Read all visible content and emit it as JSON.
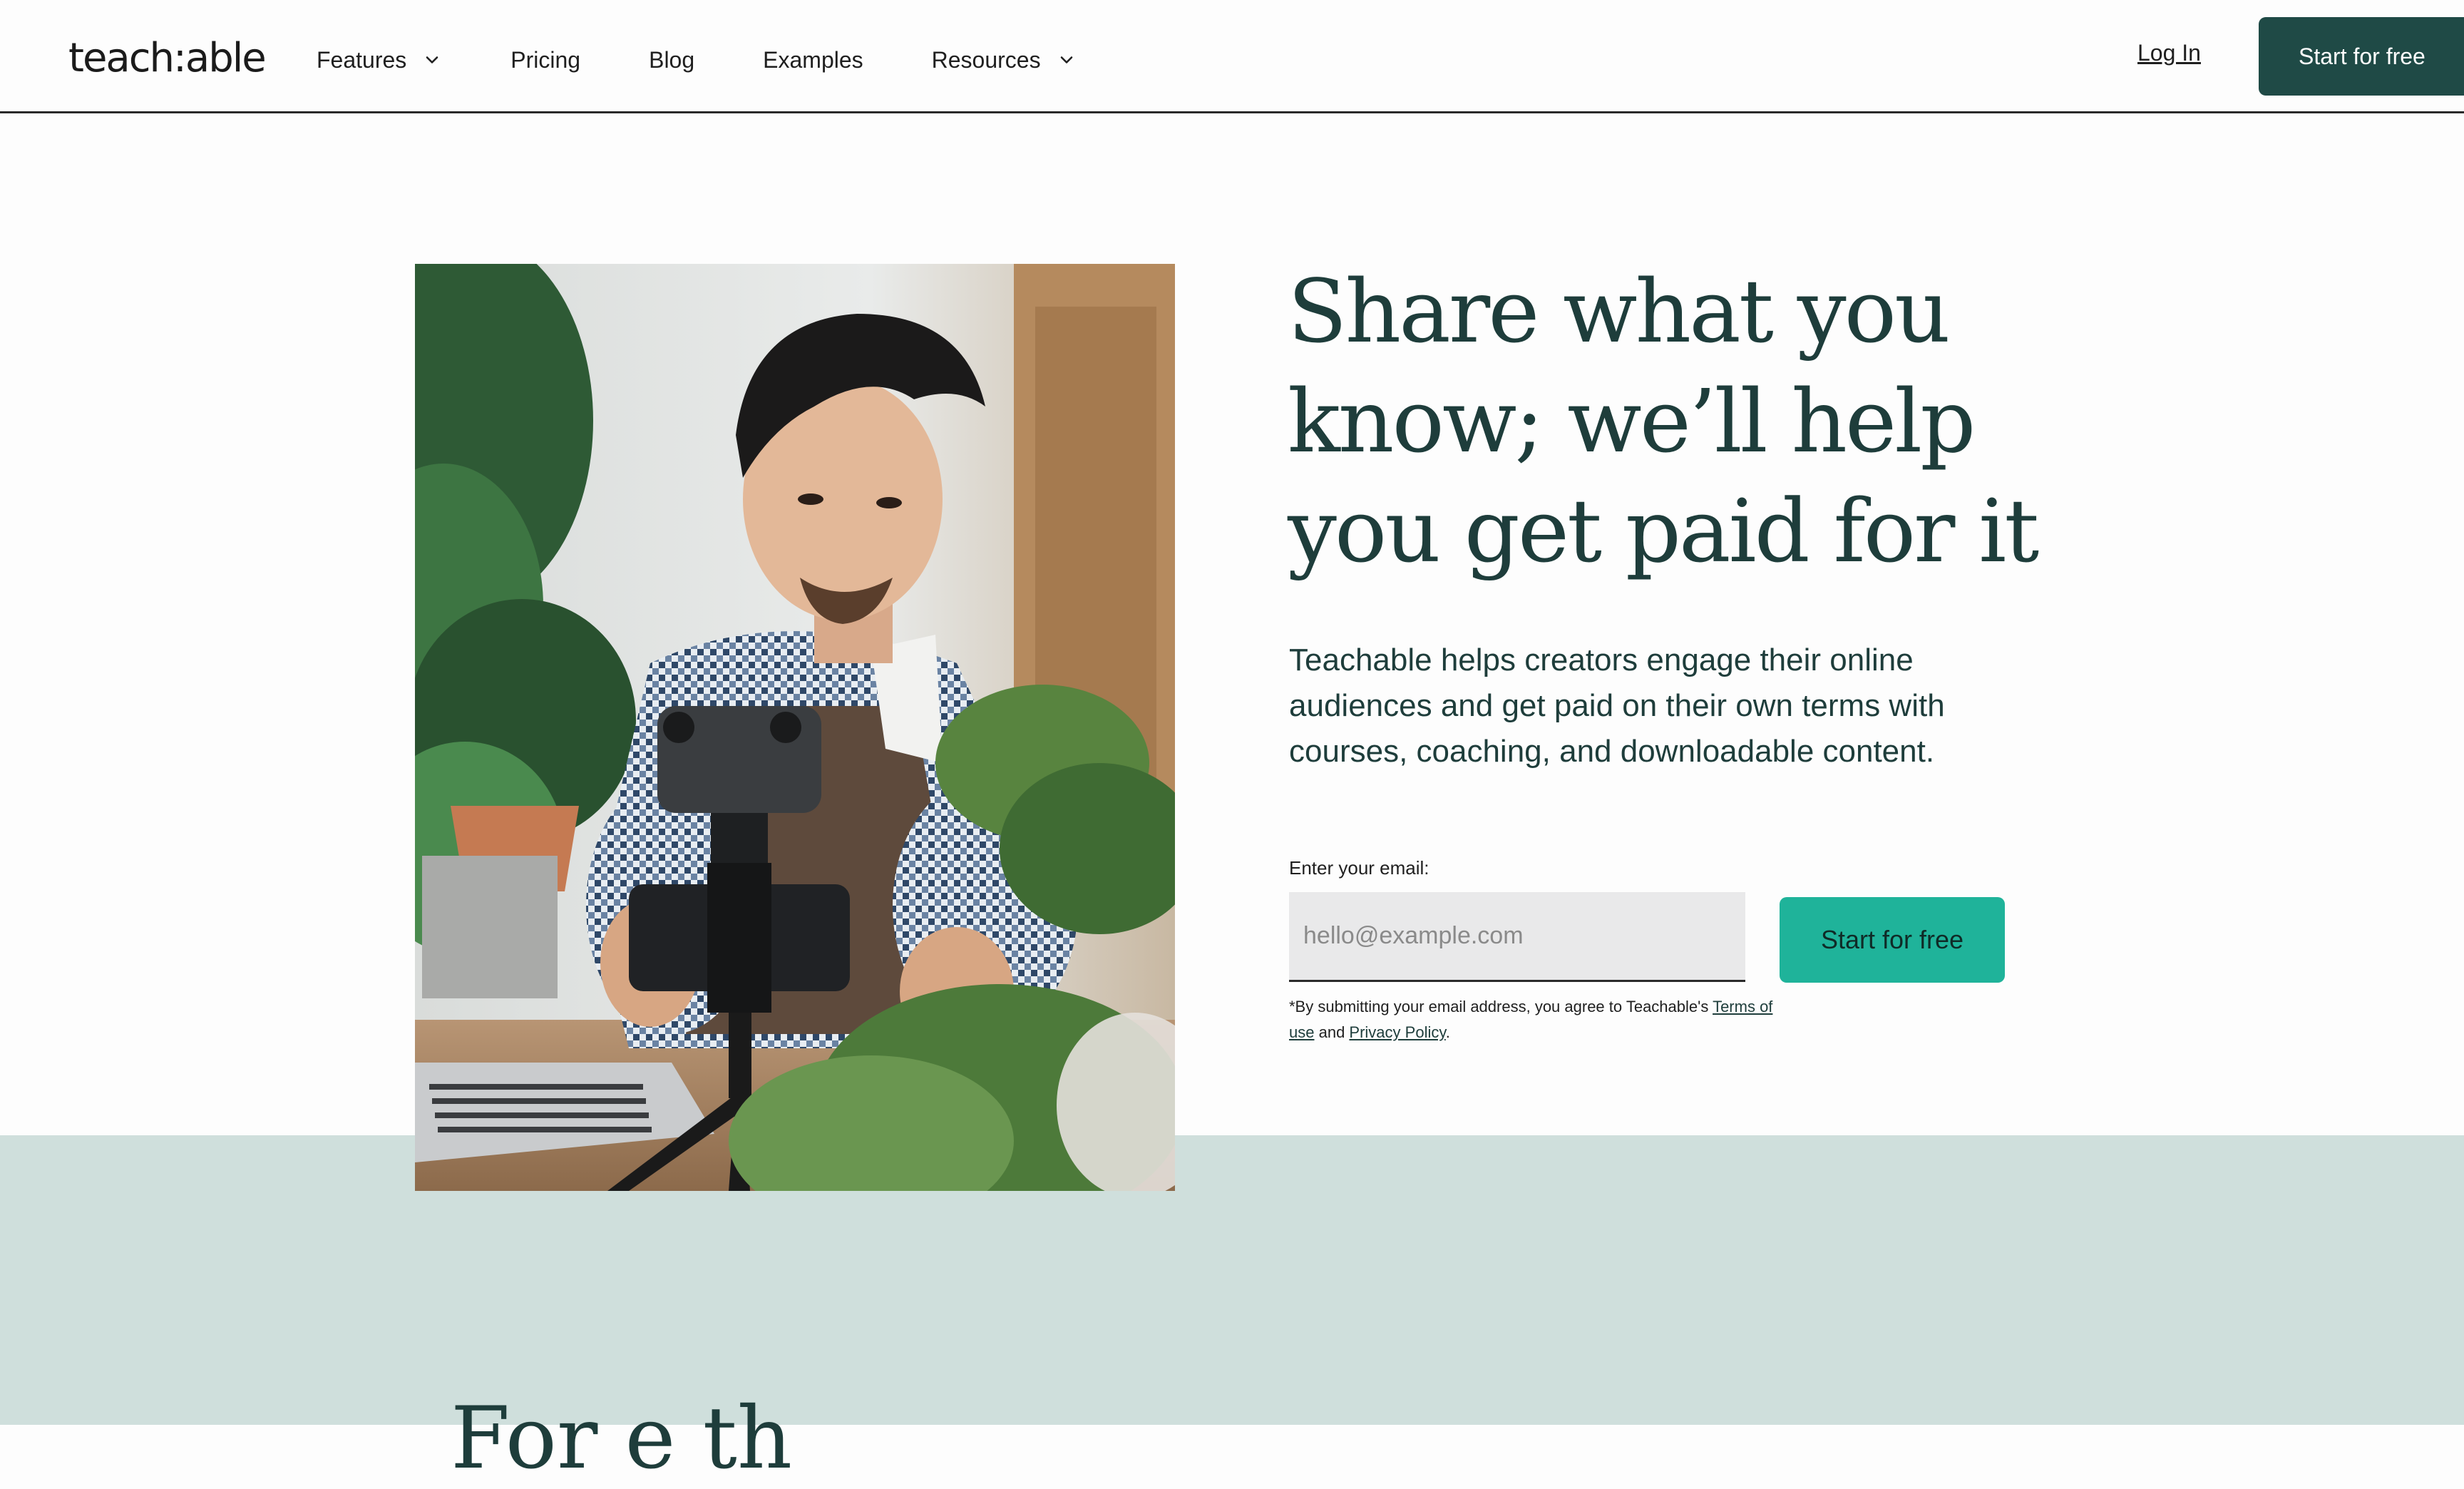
{
  "brand": {
    "logo_text": "teach:able",
    "colors": {
      "dark_green": "#1f4a46",
      "teal_accent": "#1fb39a",
      "band_bg": "#cfdfdc",
      "text_primary": "#1e3d3b"
    }
  },
  "nav": {
    "items": [
      {
        "label": "Features",
        "has_dropdown": true
      },
      {
        "label": "Pricing",
        "has_dropdown": false
      },
      {
        "label": "Blog",
        "has_dropdown": false
      },
      {
        "label": "Examples",
        "has_dropdown": false
      },
      {
        "label": "Resources",
        "has_dropdown": true
      }
    ],
    "dropdown_icon": "chevron-down-icon",
    "login_label": "Log In",
    "cta_label": "Start for free"
  },
  "hero": {
    "headline": "Share what you know; we’ll help you get paid for it",
    "subhead": "Teachable helps creators engage their online audiences and get paid on their own terms with courses, coaching, and downloadable content.",
    "image_alt": "Creator filming plants with a phone on a tripod",
    "form": {
      "email_label": "Enter your email:",
      "email_placeholder": "hello@example.com",
      "email_value": "",
      "submit_label": "Start for free"
    },
    "disclaimer": {
      "prefix": "*By submitting your email address, you agree to Teachable's ",
      "terms_label": "Terms of use",
      "middle": " and ",
      "privacy_label": "Privacy Policy",
      "suffix": "."
    }
  },
  "next_section": {
    "heading_partial": "For e  th"
  }
}
